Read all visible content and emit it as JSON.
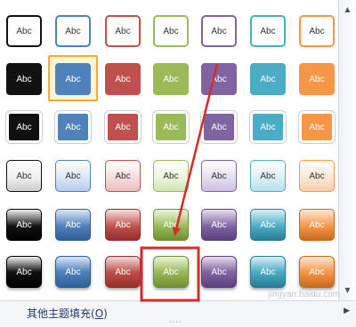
{
  "swatch_label": "Abc",
  "palette": [
    {
      "name": "black",
      "c": "#111111",
      "l": "#f0f0f0",
      "l2": "#cccccc",
      "d": "#000000"
    },
    {
      "name": "blue",
      "c": "#4f81bd",
      "l": "#dbe7f7",
      "l2": "#b7cbe8",
      "d": "#2f5f99"
    },
    {
      "name": "red",
      "c": "#c0504d",
      "l": "#f6dede",
      "l2": "#ebbdbc",
      "d": "#962f2c"
    },
    {
      "name": "green",
      "c": "#9bbb59",
      "l": "#eef5de",
      "l2": "#d3e4b2",
      "d": "#6f8f32"
    },
    {
      "name": "purple",
      "c": "#8064a2",
      "l": "#e7dff0",
      "l2": "#cfc0e0",
      "d": "#5b417c"
    },
    {
      "name": "aqua",
      "c": "#4bacc6",
      "l": "#dcf0f6",
      "l2": "#b7e0ec",
      "d": "#287d94"
    },
    {
      "name": "orange",
      "c": "#f79646",
      "l": "#fde8d6",
      "l2": "#f9cda9",
      "d": "#c96a1b"
    }
  ],
  "rows": 6,
  "selected": {
    "row": 1,
    "col": 1
  },
  "highlighted": {
    "row": 5,
    "col": 3
  },
  "footer": {
    "label": "其他主题填充(",
    "accel": "O",
    "close": ")"
  },
  "watermark": "jingyan.baidu.com",
  "colors": {
    "highlight_box": "#d62b2b",
    "arrow": "#d62b2b",
    "selected_border": "#f2a93b"
  }
}
